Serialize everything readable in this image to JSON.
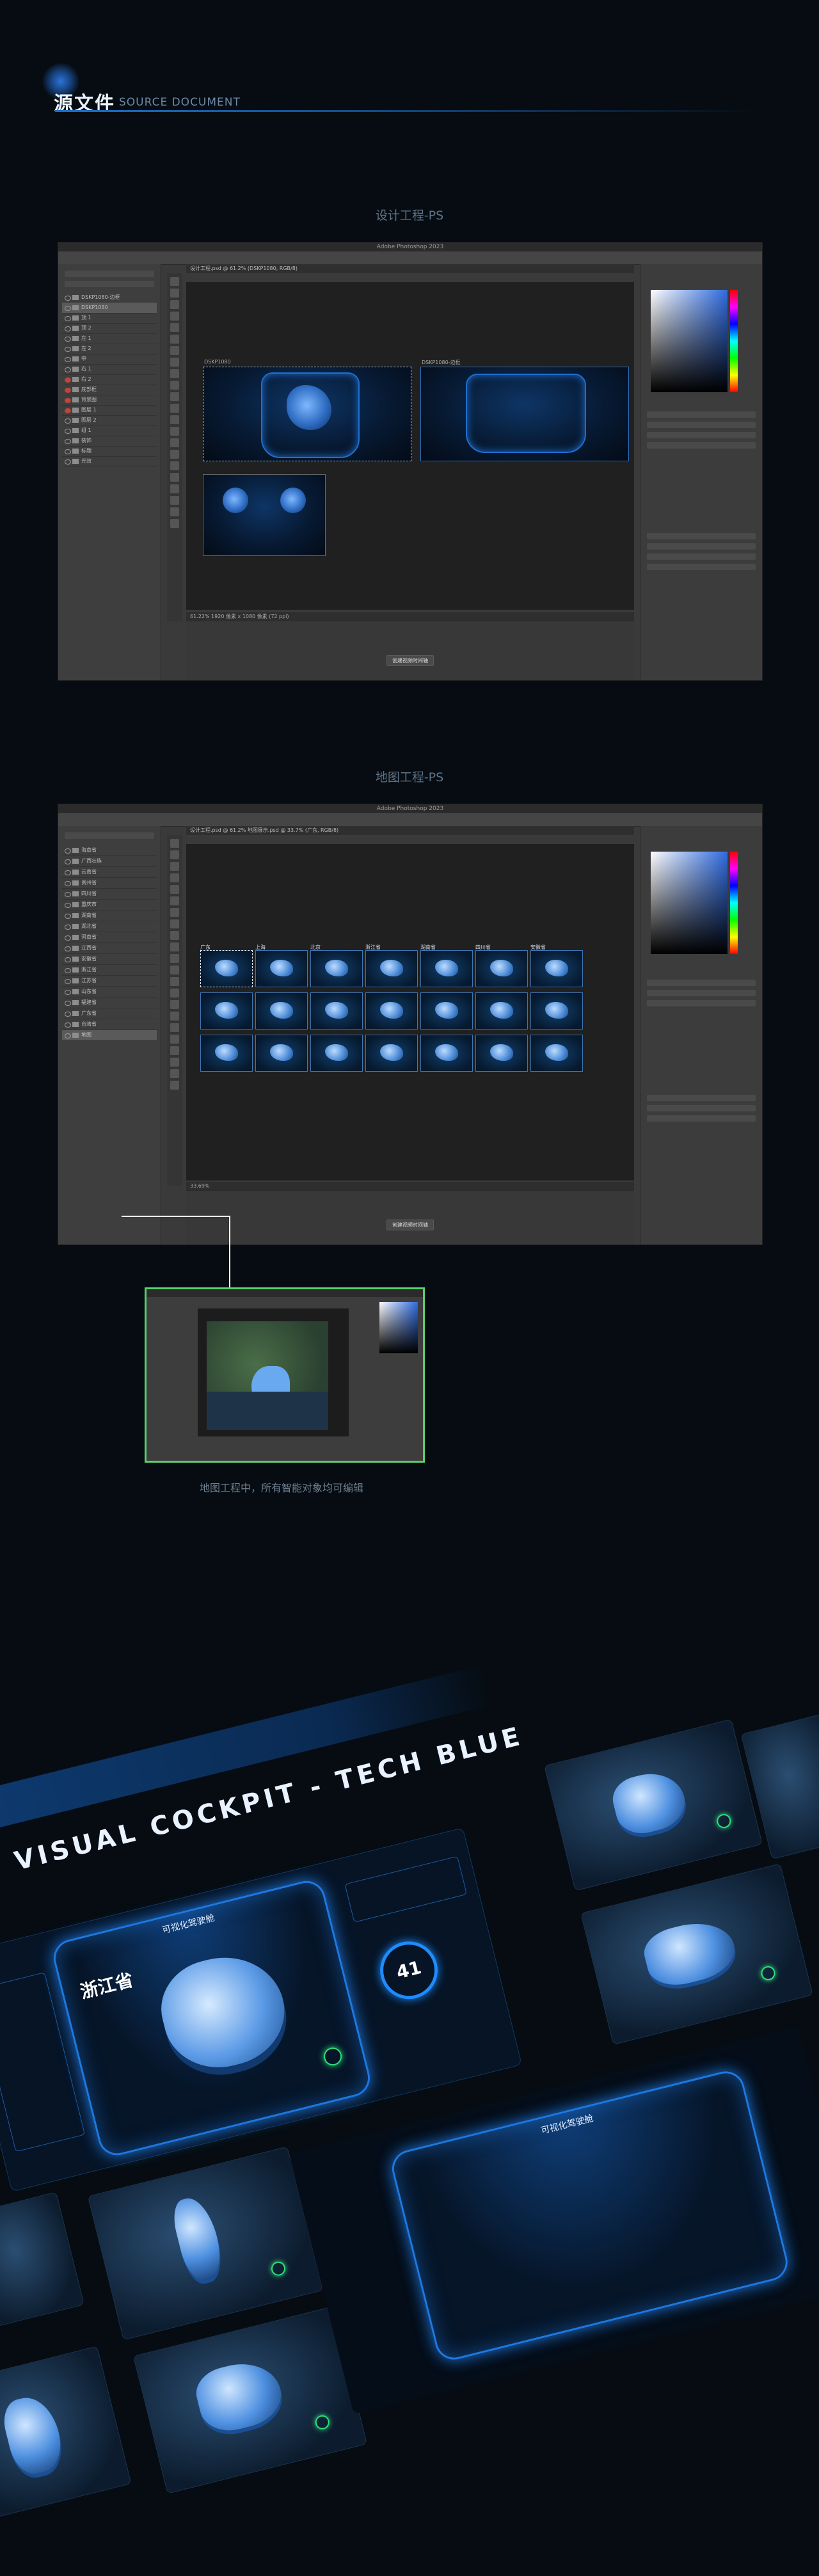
{
  "header": {
    "title": "源文件",
    "subtitle": "SOURCE DOCUMENT"
  },
  "section1": {
    "title": "设计工程-PS",
    "app_title": "Adobe Photoshop 2023",
    "tab": "设计工程.psd @ 61.2% (DSKP1080, RGB/8)",
    "artboard1_label": "DSKP1080",
    "artboard2_label": "DSKP1080-边框",
    "status": "61.22%  1920 像素 x 1080 像素 (72 ppi)",
    "timeline_button": "创建视频时间轴",
    "layer_names": [
      "DSKP1080-边框",
      "DSKP1080",
      "顶 1",
      "顶 2",
      "左 1",
      "左 2",
      "中",
      "右 1",
      "右 2",
      "底部框",
      "背景图",
      "图层 1",
      "图层 2",
      "组 1",
      "装饰",
      "标题",
      "光效"
    ]
  },
  "section2": {
    "title": "地图工程-PS",
    "app_title": "Adobe Photoshop 2023",
    "tab": "设计工程.psd @ 61.2%    地图展示.psd @ 33.7% (广东, RGB/8)",
    "status": "33.69%",
    "timeline_button": "创建视频时间轴",
    "thumb_labels": [
      "广东",
      "上海",
      "北京",
      "浙江省",
      "湖南省",
      "四川省",
      "安徽省"
    ],
    "layer_names": [
      "海南省",
      "广西壮族",
      "云南省",
      "贵州省",
      "四川省",
      "重庆市",
      "湖南省",
      "湖北省",
      "河南省",
      "江西省",
      "安徽省",
      "浙江省",
      "江苏省",
      "山东省",
      "福建省",
      "广东省",
      "台湾省",
      "地图"
    ]
  },
  "caption": "地图工程中，所有智能对象均可编辑",
  "showcase": {
    "banner": "VISUAL COCKPIT - TECH BLUE",
    "dashboard_title": "可视化驾驶舱",
    "province": "浙江省",
    "gauge_value": "41",
    "frame_title": "可视化驾驶舱"
  },
  "colors": {
    "background": "#060c12",
    "accent": "#1e78e0",
    "callout_border": "#58d16a"
  }
}
